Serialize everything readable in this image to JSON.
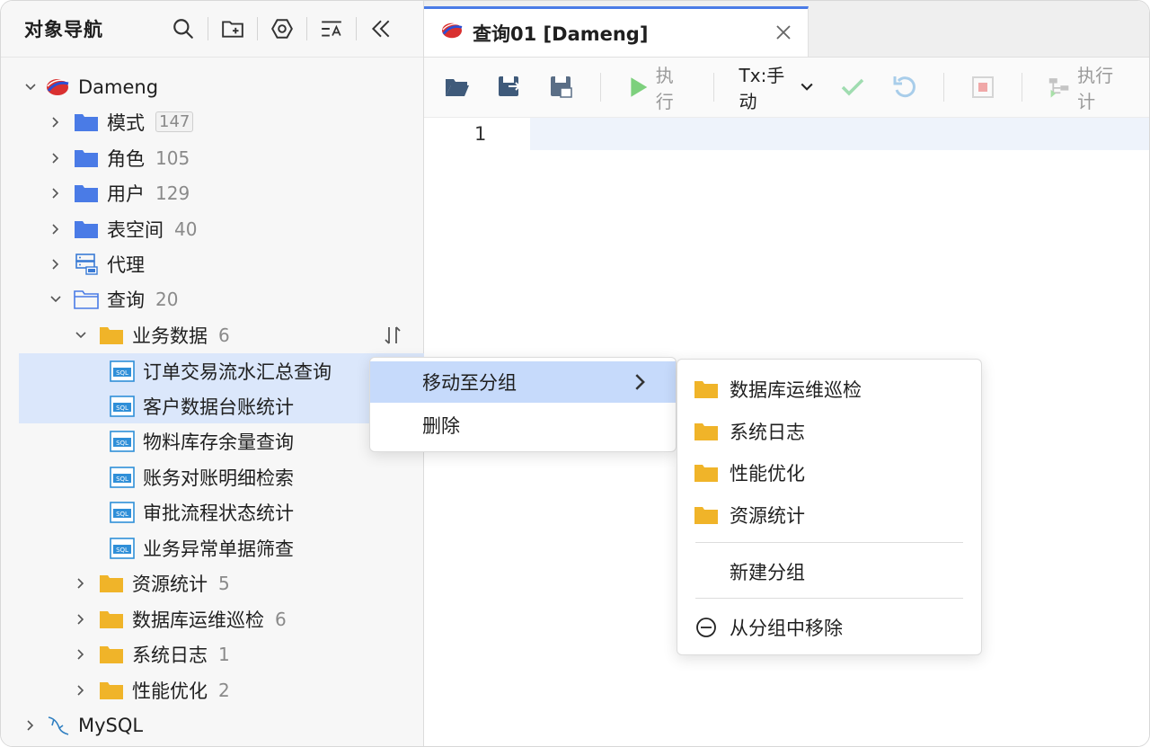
{
  "nav": {
    "title": "对象导航",
    "tools": [
      "search-icon",
      "new-folder-icon",
      "settings-hex-icon",
      "filter-list-icon",
      "collapse-left-icon"
    ]
  },
  "tree": {
    "dameng": {
      "label": "Dameng"
    },
    "schema": {
      "label": "模式",
      "count": "147"
    },
    "role": {
      "label": "角色",
      "count": "105"
    },
    "user": {
      "label": "用户",
      "count": "129"
    },
    "tablespace": {
      "label": "表空间",
      "count": "40"
    },
    "proxy": {
      "label": "代理"
    },
    "query": {
      "label": "查询",
      "count": "20"
    },
    "business": {
      "label": "业务数据",
      "count": "6"
    },
    "files": [
      {
        "label": "订单交易流水汇总查询"
      },
      {
        "label": "客户数据台账统计"
      },
      {
        "label": "物料库存余量查询"
      },
      {
        "label": "账务对账明细检索"
      },
      {
        "label": "审批流程状态统计"
      },
      {
        "label": "业务异常单据筛查"
      }
    ],
    "groups": [
      {
        "label": "资源统计",
        "count": "5"
      },
      {
        "label": "数据库运维巡检",
        "count": "6"
      },
      {
        "label": "系统日志",
        "count": "1"
      },
      {
        "label": "性能优化",
        "count": "2"
      }
    ],
    "mysql": {
      "label": "MySQL"
    }
  },
  "editor": {
    "tab": {
      "label": "查询01 [Dameng]"
    },
    "toolbar": {
      "run": "执行",
      "tx": "Tx:手动",
      "plan": "执行计"
    },
    "line_number": "1"
  },
  "context_menu": {
    "move_to_group": "移动至分组",
    "delete": "删除"
  },
  "submenu": {
    "groups": [
      "数据库运维巡检",
      "系统日志",
      "性能优化",
      "资源统计"
    ],
    "new_group": "新建分组",
    "remove_from_group": "从分组中移除"
  },
  "colors": {
    "folder_blue": "#4a7be6",
    "folder_yellow": "#f0b429",
    "selection": "#dbe7fb",
    "menu_active": "#c6dafb",
    "run_green": "#7dd07d"
  }
}
